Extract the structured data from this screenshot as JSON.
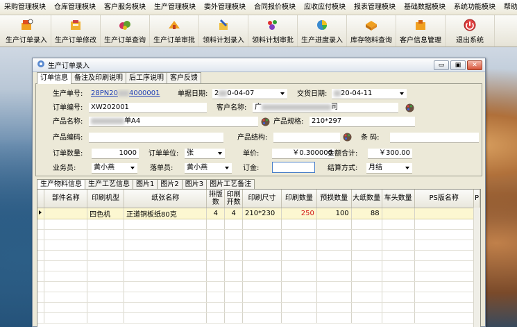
{
  "menu": [
    "采购管理模块",
    "仓库管理模块",
    "客户服务模块",
    "生产管理模块",
    "委外管理模块",
    "合同报价模块",
    "应收应付模块",
    "报表管理模块",
    "基础数据模块",
    "系统功能模块",
    "帮助"
  ],
  "toolbar": [
    {
      "label": "生产订单录入",
      "icon": "order-entry-icon"
    },
    {
      "label": "生产订单修改",
      "icon": "order-edit-icon"
    },
    {
      "label": "生产订单查询",
      "icon": "order-query-icon"
    },
    {
      "label": "生产订单审批",
      "icon": "order-approve-icon"
    },
    {
      "label": "领料计划录入",
      "icon": "material-plan-entry-icon"
    },
    {
      "label": "领料计划审批",
      "icon": "material-plan-approve-icon"
    },
    {
      "label": "生产进度录入",
      "icon": "progress-entry-icon"
    },
    {
      "label": "库存物料查询",
      "icon": "inventory-query-icon"
    },
    {
      "label": "客户信息管理",
      "icon": "customer-info-icon"
    },
    {
      "label": "退出系统",
      "icon": "exit-icon"
    }
  ],
  "window": {
    "title": "生产订单录入",
    "tabs": [
      "订单信息",
      "备注及印刷说明",
      "后工序说明",
      "客户反馈"
    ],
    "controls": {
      "minimize": "▭",
      "restore": "▣",
      "close": "✕"
    }
  },
  "form": {
    "production_no_label": "生产单号:",
    "production_no_prefix": "28PN20",
    "production_no_suffix": "4000001",
    "doc_date_label": "单据日期:",
    "doc_date_a": "2",
    "doc_date_b": "0-04-07",
    "delivery_date_label": "交货日期:",
    "delivery_date": "20-04-11",
    "order_no_label": "订单编号:",
    "order_no": "XW202001",
    "customer_label": "客户名称:",
    "customer_prefix": "广",
    "customer_suffix": "司",
    "product_name_label": "产品名称:",
    "product_name_suffix": "单A4",
    "product_spec_label": "产品规格:",
    "product_spec": "210*297",
    "product_code_label": "产品编码:",
    "product_code": "",
    "product_structure_label": "产品结构:",
    "product_structure": "",
    "barcode_label": "条 码:",
    "barcode": "",
    "order_qty_label": "订单数量:",
    "order_qty": "1000",
    "order_unit_label": "订单单位:",
    "order_unit": "张",
    "unit_price_label": "单价:",
    "unit_price": "￥0.300000",
    "total_amount_label": "金额合计:",
    "total_amount": "￥300.00",
    "salesman_label": "业务员:",
    "salesman": "黄小燕",
    "scheduler_label": "落单员:",
    "scheduler": "黄小燕",
    "deposit_label": "订金:",
    "deposit": "",
    "settlement_label": "结算方式:",
    "settlement": "月结"
  },
  "lower_tabs": [
    "生产物料信息",
    "生产工艺信息",
    "图片1",
    "图片2",
    "图片3",
    "图片工艺备注"
  ],
  "grid": {
    "columns": [
      "部件名称",
      "印刷机型",
      "纸张名称",
      "排版\n数",
      "印刷\n开数",
      "印刷尺寸",
      "印刷数量",
      "预损数量",
      "大纸数量",
      "车头数量",
      "PS版名称",
      "P"
    ],
    "rows": [
      {
        "part": "",
        "press": "四色机",
        "paper": "正道铜板纸80克",
        "layout": "4",
        "open": "4",
        "size": "210*230",
        "print_qty": "250",
        "loss_qty": "100",
        "big_qty": "88",
        "head_qty": "",
        "ps_name": ""
      }
    ]
  }
}
